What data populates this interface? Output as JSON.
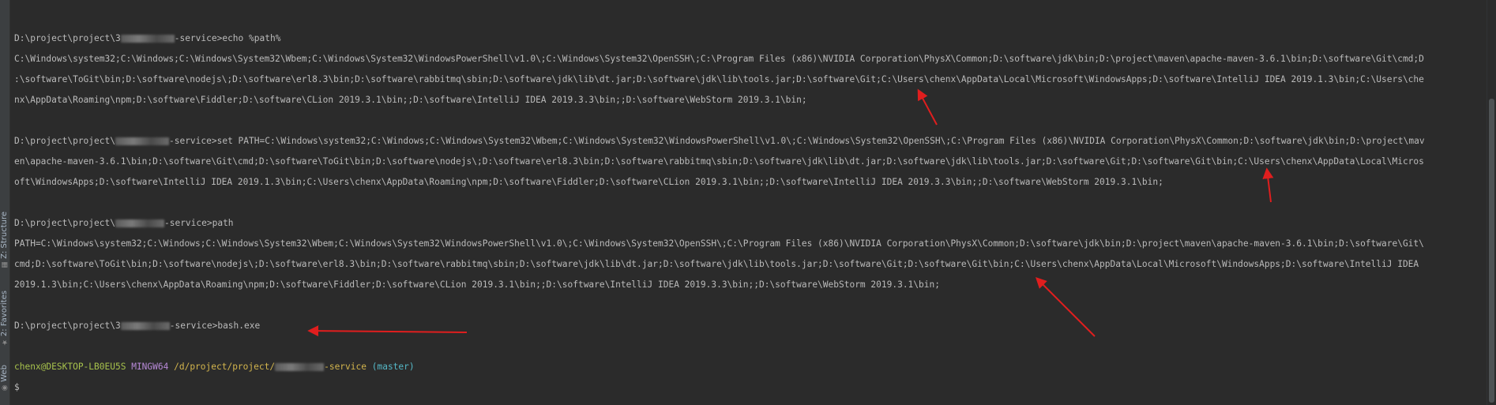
{
  "sidebar": {
    "tabs": [
      {
        "label": "Z: Structure",
        "icon": "structure-icon"
      },
      {
        "label": "2: Favorites",
        "icon": "star-icon"
      },
      {
        "label": "Web",
        "icon": "web-icon"
      }
    ]
  },
  "terminal": {
    "lines": {
      "l1_prefix": "D:\\project\\project\\3",
      "l1_suffix": "-service>echo %path%",
      "l2": "C:\\Windows\\system32;C:\\Windows;C:\\Windows\\System32\\Wbem;C:\\Windows\\System32\\WindowsPowerShell\\v1.0\\;C:\\Windows\\System32\\OpenSSH\\;C:\\Program Files (x86)\\NVIDIA Corporation\\PhysX\\Common;D:\\software\\jdk\\bin;D:\\project\\maven\\apache-maven-3.6.1\\bin;D:\\software\\Git\\cmd;D",
      "l3": ":\\software\\ToGit\\bin;D:\\software\\nodejs\\;D:\\software\\erl8.3\\bin;D:\\software\\rabbitmq\\sbin;D:\\software\\jdk\\lib\\dt.jar;D:\\software\\jdk\\lib\\tools.jar;D:\\software\\Git;C:\\Users\\chenx\\AppData\\Local\\Microsoft\\WindowsApps;D:\\software\\IntelliJ IDEA 2019.1.3\\bin;C:\\Users\\che",
      "l4": "nx\\AppData\\Roaming\\npm;D:\\software\\Fiddler;D:\\software\\CLion 2019.3.1\\bin;;D:\\software\\IntelliJ IDEA 2019.3.3\\bin;;D:\\software\\WebStorm 2019.3.1\\bin;",
      "l6_prefix": "D:\\project\\project\\",
      "l6_suffix": "-service>set PATH=C:\\Windows\\system32;C:\\Windows;C:\\Windows\\System32\\Wbem;C:\\Windows\\System32\\WindowsPowerShell\\v1.0\\;C:\\Windows\\System32\\OpenSSH\\;C:\\Program Files (x86)\\NVIDIA Corporation\\PhysX\\Common;D:\\software\\jdk\\bin;D:\\project\\mav",
      "l7": "en\\apache-maven-3.6.1\\bin;D:\\software\\Git\\cmd;D:\\software\\ToGit\\bin;D:\\software\\nodejs\\;D:\\software\\erl8.3\\bin;D:\\software\\rabbitmq\\sbin;D:\\software\\jdk\\lib\\dt.jar;D:\\software\\jdk\\lib\\tools.jar;D:\\software\\Git;D:\\software\\Git\\bin;C:\\Users\\chenx\\AppData\\Local\\Micros",
      "l8": "oft\\WindowsApps;D:\\software\\IntelliJ IDEA 2019.1.3\\bin;C:\\Users\\chenx\\AppData\\Roaming\\npm;D:\\software\\Fiddler;D:\\software\\CLion 2019.3.1\\bin;;D:\\software\\IntelliJ IDEA 2019.3.3\\bin;;D:\\software\\WebStorm 2019.3.1\\bin;",
      "l10_prefix": "D:\\project\\project\\",
      "l10_suffix": "-service>path",
      "l11": "PATH=C:\\Windows\\system32;C:\\Windows;C:\\Windows\\System32\\Wbem;C:\\Windows\\System32\\WindowsPowerShell\\v1.0\\;C:\\Windows\\System32\\OpenSSH\\;C:\\Program Files (x86)\\NVIDIA Corporation\\PhysX\\Common;D:\\software\\jdk\\bin;D:\\project\\maven\\apache-maven-3.6.1\\bin;D:\\software\\Git\\",
      "l12": "cmd;D:\\software\\ToGit\\bin;D:\\software\\nodejs\\;D:\\software\\erl8.3\\bin;D:\\software\\rabbitmq\\sbin;D:\\software\\jdk\\lib\\dt.jar;D:\\software\\jdk\\lib\\tools.jar;D:\\software\\Git;D:\\software\\Git\\bin;C:\\Users\\chenx\\AppData\\Local\\Microsoft\\WindowsApps;D:\\software\\IntelliJ IDEA",
      "l13": "2019.1.3\\bin;C:\\Users\\chenx\\AppData\\Roaming\\npm;D:\\software\\Fiddler;D:\\software\\CLion 2019.3.1\\bin;;D:\\software\\IntelliJ IDEA 2019.3.3\\bin;;D:\\software\\WebStorm 2019.3.1\\bin;",
      "l15_prefix": "D:\\project\\project\\3",
      "l15_suffix": "-service>bash.exe",
      "l17_user": "chenx@DESKTOP-LB0EU5S",
      "l17_env": "MINGW64",
      "l17_path_prefix": "/d/project/project/",
      "l17_path_suffix": "-service",
      "l17_branch": "(master)",
      "l18": "$"
    }
  },
  "colors": {
    "background": "#2b2b2b",
    "text": "#bbbbbb",
    "arrow": "#e01e1e",
    "bash_user": "#a7c24c",
    "bash_env": "#b88ad8",
    "bash_path": "#d3b54d",
    "bash_branch": "#55b8c7"
  }
}
